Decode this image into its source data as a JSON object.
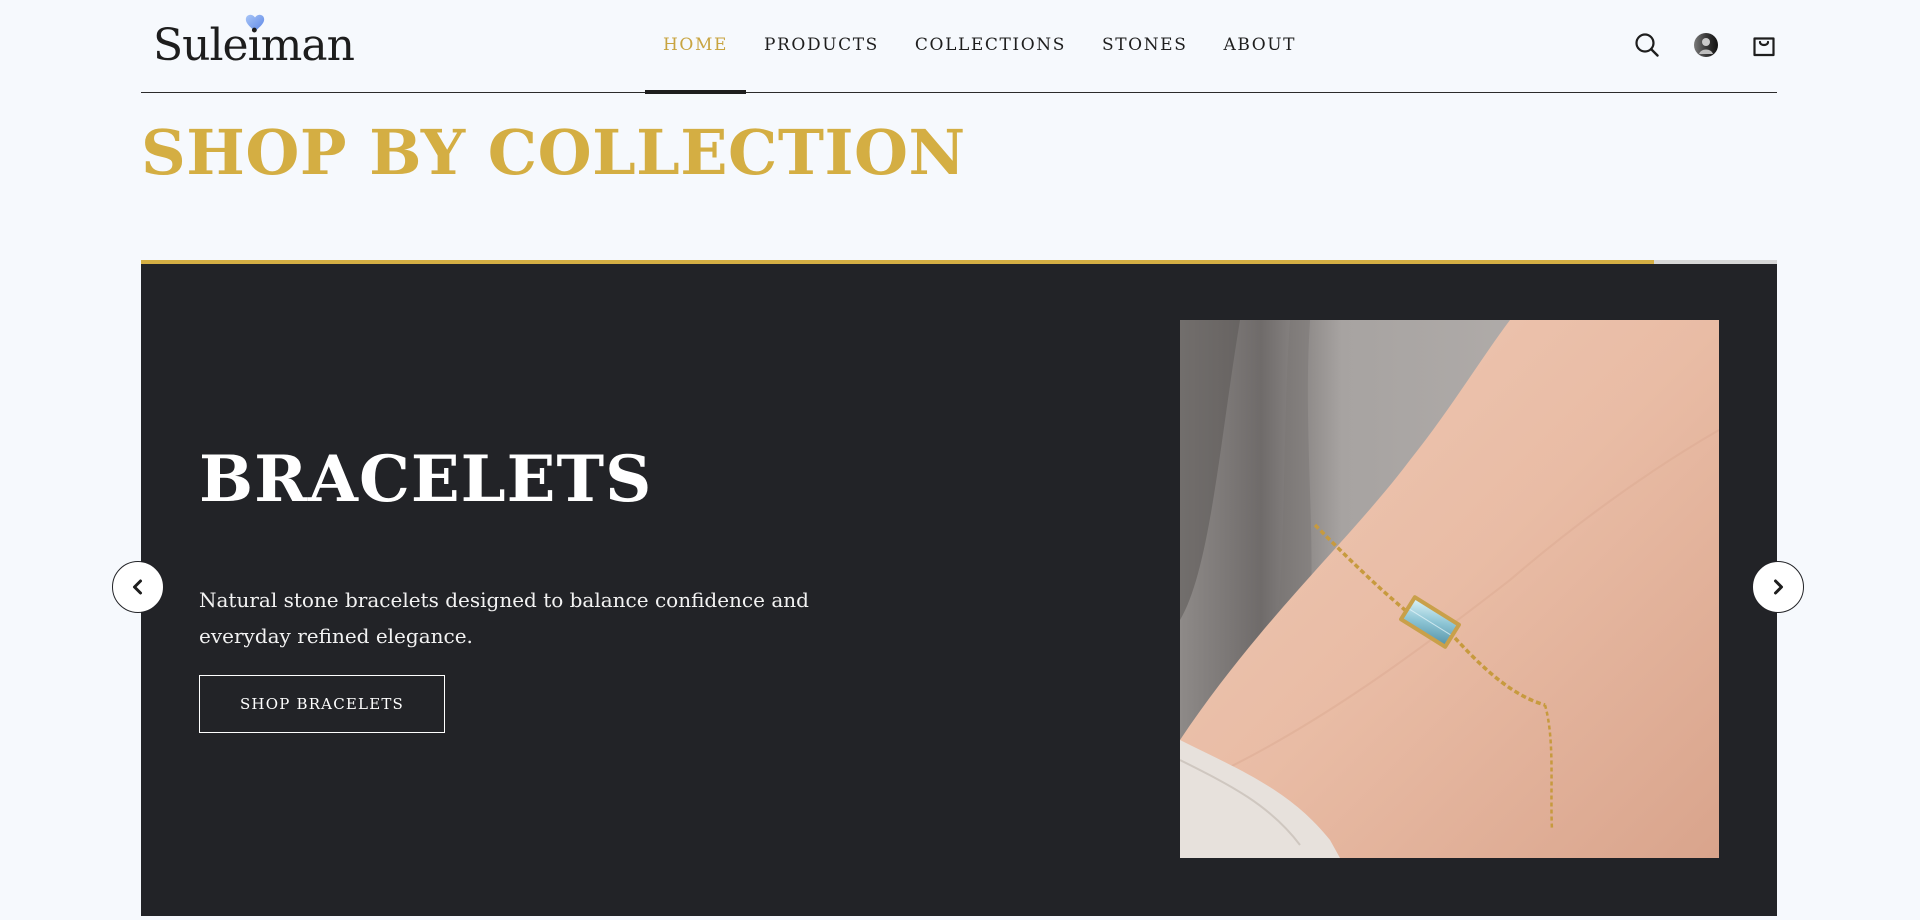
{
  "brand": {
    "logo_text": "Suleiman",
    "accent": "#d4ae43",
    "heart_color": "#7fa8ef"
  },
  "nav": {
    "items": [
      {
        "label": "HOME",
        "active": true
      },
      {
        "label": "PRODUCTS",
        "active": false
      },
      {
        "label": "COLLECTIONS",
        "active": false
      },
      {
        "label": "STONES",
        "active": false
      },
      {
        "label": "ABOUT",
        "active": false
      }
    ],
    "icons": [
      "search-icon",
      "avatar",
      "shopping-bag-icon"
    ]
  },
  "section": {
    "title": "SHOP BY COLLECTION"
  },
  "carousel": {
    "progress": 0.925,
    "slide": {
      "title": "BRACELETS",
      "description": "Natural stone bracelets designed to balance confidence and everyday refined elegance.",
      "button_label": "SHOP BRACELETS",
      "image": "photo-bracelet-on-wrist"
    },
    "prev_icon": "chevron-left-icon",
    "next_icon": "chevron-right-icon"
  },
  "colors": {
    "page_bg": "#f6f9fd",
    "slide_bg": "#222327",
    "text_dark": "#1e1e1e"
  }
}
